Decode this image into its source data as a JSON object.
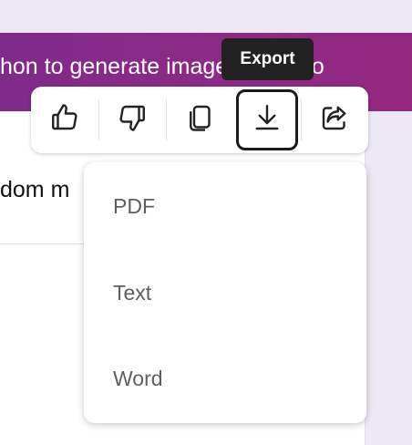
{
  "conversation": {
    "prompt_text": "hon to generate image form 1 to",
    "response_text": "dom m"
  },
  "toolbar": {
    "buttons": [
      {
        "name": "thumbs-up",
        "icon": "thumbs-up-icon"
      },
      {
        "name": "thumbs-down",
        "icon": "thumbs-down-icon"
      },
      {
        "name": "copy",
        "icon": "copy-icon"
      },
      {
        "name": "export",
        "icon": "download-icon",
        "active": true
      },
      {
        "name": "share",
        "icon": "share-icon"
      }
    ],
    "tooltip": "Export"
  },
  "export_menu": {
    "items": [
      "PDF",
      "Text",
      "Word"
    ]
  },
  "colors": {
    "prompt_bubble": "#8e2a86",
    "background": "#ece8f4",
    "tooltip_bg": "#222222",
    "menu_text": "#5f5f5f"
  }
}
